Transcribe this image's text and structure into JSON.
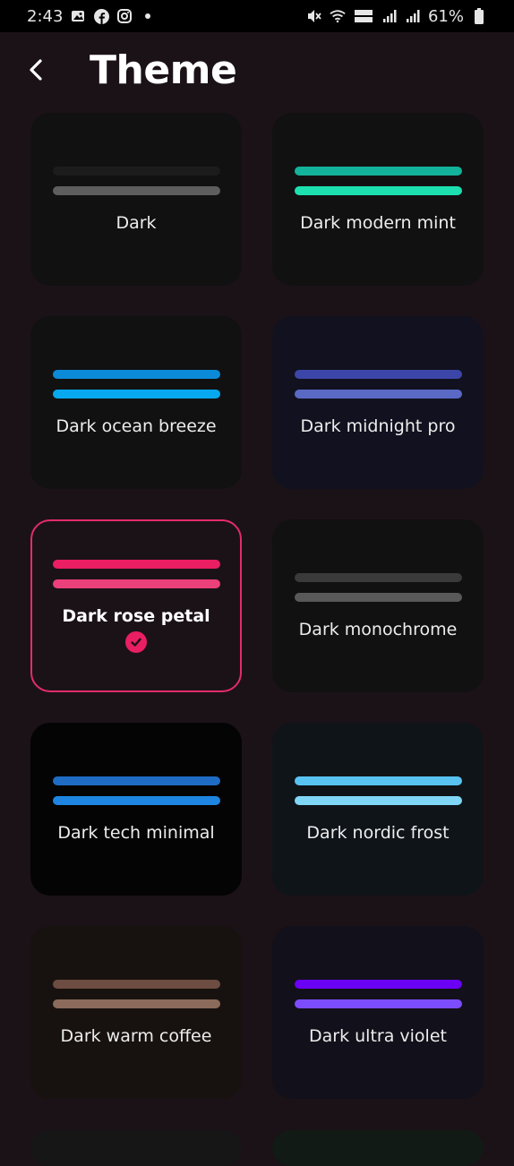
{
  "status": {
    "time": "2:43",
    "battery": "61%"
  },
  "header": {
    "title": "Theme"
  },
  "themes": [
    {
      "label": "Dark",
      "bg": "#111111",
      "c1": "#1c1c1c",
      "c2": "#5e5e5e",
      "selected": false
    },
    {
      "label": "Dark modern mint",
      "bg": "#111111",
      "c1": "#13b29a",
      "c2": "#1de0b0",
      "selected": false
    },
    {
      "label": "Dark ocean breeze",
      "bg": "#111111",
      "c1": "#0b8ad8",
      "c2": "#07a8f0",
      "selected": false
    },
    {
      "label": "Dark midnight pro",
      "bg": "#12111f",
      "c1": "#3c46a8",
      "c2": "#5a69c4",
      "selected": false
    },
    {
      "label": "Dark rose petal",
      "bg": "#1b1217",
      "c1": "#e91e63",
      "c2": "#ec407a",
      "selected": true
    },
    {
      "label": "Dark monochrome",
      "bg": "#111111",
      "c1": "#3a3a3a",
      "c2": "#595959",
      "selected": false
    },
    {
      "label": "Dark tech minimal",
      "bg": "#040404",
      "c1": "#1f6cc4",
      "c2": "#1e86e2",
      "selected": false
    },
    {
      "label": "Dark nordic frost",
      "bg": "#0f1418",
      "c1": "#58c3f0",
      "c2": "#80d6f6",
      "selected": false
    },
    {
      "label": "Dark warm coffee",
      "bg": "#17120f",
      "c1": "#6d4c41",
      "c2": "#8b6b5c",
      "selected": false
    },
    {
      "label": "Dark ultra violet",
      "bg": "#12101a",
      "c1": "#6a00f4",
      "c2": "#7c4dff",
      "selected": false
    }
  ],
  "colors": {
    "accent": "#e91e63",
    "page_bg": "#1b1217"
  }
}
